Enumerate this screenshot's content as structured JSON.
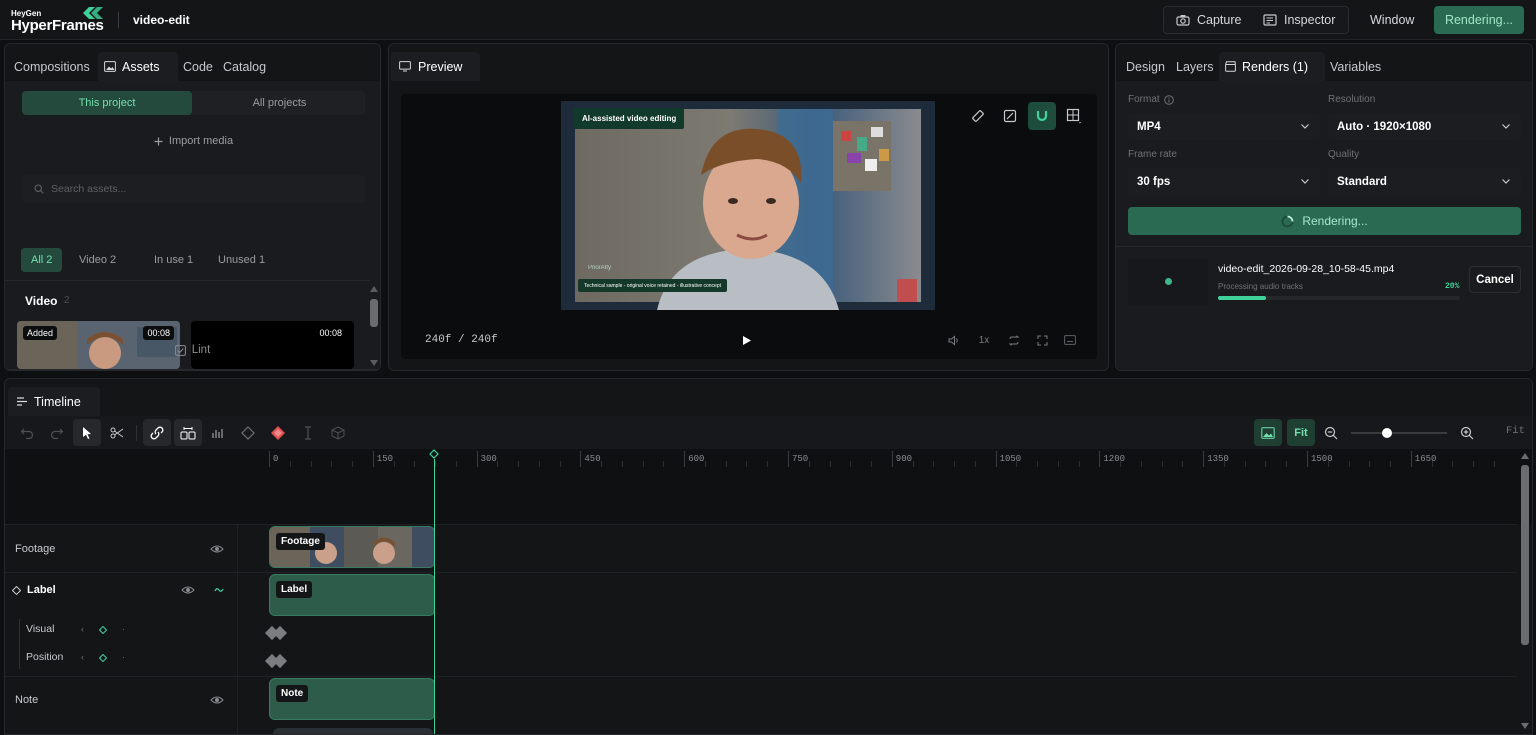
{
  "topbar": {
    "logo_small": "HeyGen",
    "logo_big": "HyperFrames",
    "project": "video-edit",
    "capture": "Capture",
    "inspector": "Inspector",
    "window": "Window",
    "rendering": "Rendering..."
  },
  "assets": {
    "tabs": [
      "Compositions",
      "Assets",
      "Code",
      "Catalog"
    ],
    "active_tab": "Assets",
    "scope": [
      "This project",
      "All projects"
    ],
    "import": "Import media",
    "search_placeholder": "Search assets...",
    "filters": [
      "All 2",
      "Video 2",
      "In use 1",
      "Unused 1"
    ],
    "section": "Video",
    "section_count": "2",
    "thumbs": [
      {
        "badge": "Added",
        "duration": "00:08"
      },
      {
        "badge": "",
        "duration": "00:08"
      }
    ],
    "lint": "Lint"
  },
  "preview": {
    "tab": "Preview",
    "video_tag": "AI-assisted video editing",
    "video_caption": "Technical sample - original voice retained - illustrative concept",
    "video_watermark": "PriorAIty",
    "frame_counter": "240f / 240f",
    "speed": "1x"
  },
  "inspector": {
    "tabs": [
      "Design",
      "Layers",
      "Renders (1)",
      "Variables"
    ],
    "active_tab": "Renders (1)",
    "format_label": "Format",
    "format_value": "MP4",
    "resolution_label": "Resolution",
    "resolution_value": "Auto · 1920×1080",
    "framerate_label": "Frame rate",
    "framerate_value": "30 fps",
    "quality_label": "Quality",
    "quality_value": "Standard",
    "render_button": "Rendering...",
    "job": {
      "filename": "video-edit_2026-09-28_10-58-45.mp4",
      "status": "Processing audio tracks",
      "percent_label": "20%",
      "progress": 0.2,
      "cancel": "Cancel"
    }
  },
  "timeline": {
    "tab": "Timeline",
    "fit": "Fit",
    "fit_right": "Fit",
    "zoom_level": 0.37,
    "ticks": [
      "0",
      "150",
      "300",
      "450",
      "600",
      "750",
      "900",
      "1050",
      "1200",
      "1350",
      "1500",
      "1650"
    ],
    "tracks": {
      "footage": "Footage",
      "label": "Label",
      "visual": "Visual",
      "position": "Position",
      "note": "Note"
    },
    "clips": {
      "footage": "Footage",
      "label": "Label",
      "note": "Note"
    }
  },
  "colors": {
    "accent": "#3fd39b",
    "accent_dark": "#2a6a52",
    "panel_bg": "#141517"
  },
  "icons": [
    "logo-mark-icon",
    "camera-icon",
    "inspector-icon",
    "image-icon",
    "plus-icon",
    "search-icon",
    "lint-icon",
    "monitor-icon",
    "ruler-icon",
    "crop-icon",
    "magnet-icon",
    "grid-icon",
    "play-icon",
    "volume-icon",
    "loop-icon",
    "fullscreen-icon",
    "caption-icon",
    "info-icon",
    "chevron-down-icon",
    "spinner-icon",
    "undo-icon",
    "redo-icon",
    "pointer-icon",
    "scissors-icon",
    "link-icon",
    "ripple-icon",
    "waveform-icon",
    "keyframe-icon",
    "keyframe-red-icon",
    "text-cursor-icon",
    "box-icon",
    "zoom-out-icon",
    "zoom-in-icon",
    "eye-icon",
    "curve-icon",
    "diamond-icon",
    "timeline-icon"
  ]
}
